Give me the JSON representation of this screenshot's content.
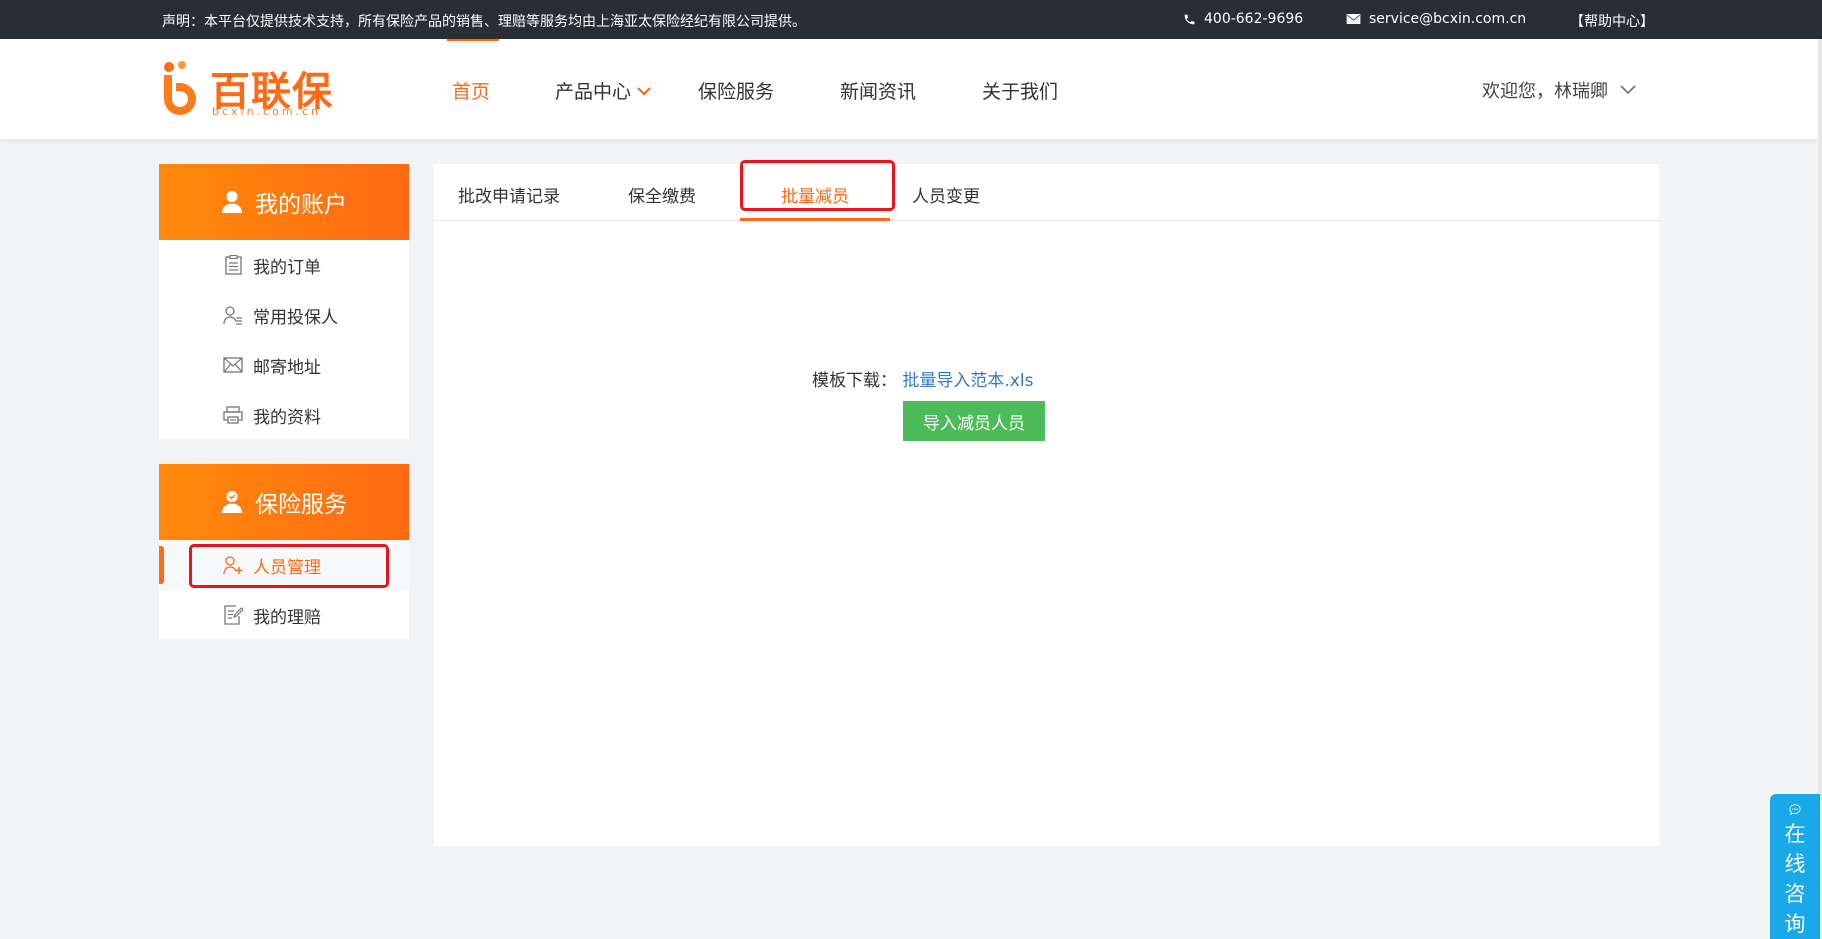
{
  "topbar": {
    "notice": "声明：本平台仅提供技术支持，所有保险产品的销售、理赔等服务均由上海亚太保险经纪有限公司提供。",
    "phone": "400-662-9696",
    "email": "service@bcxin.com.cn",
    "help": "【帮助中心】"
  },
  "logo": {
    "brand": "百联保",
    "domain": "bcxin.com.cn"
  },
  "nav": {
    "items": [
      {
        "label": "首页",
        "active": true
      },
      {
        "label": "产品中心"
      },
      {
        "label": "保险服务"
      },
      {
        "label": "新闻资讯"
      },
      {
        "label": "关于我们"
      }
    ]
  },
  "user": {
    "greeting": "欢迎您，林瑞卿"
  },
  "sidebar": {
    "account": {
      "title": "我的账户",
      "items": [
        {
          "label": "我的订单",
          "icon": "clipboard-icon"
        },
        {
          "label": "常用投保人",
          "icon": "person-list-icon"
        },
        {
          "label": "邮寄地址",
          "icon": "envelope-icon"
        },
        {
          "label": "我的资料",
          "icon": "printer-icon"
        }
      ]
    },
    "service": {
      "title": "保险服务",
      "items": [
        {
          "label": "人员管理",
          "icon": "person-add-icon",
          "active": true
        },
        {
          "label": "我的理赔",
          "icon": "edit-doc-icon"
        }
      ]
    }
  },
  "main": {
    "tabs": [
      {
        "label": "批改申请记录"
      },
      {
        "label": "保全缴费"
      },
      {
        "label": "批量减员",
        "active": true
      },
      {
        "label": "人员变更"
      }
    ],
    "template_label": "模板下载：",
    "template_link": "批量导入范本.xls",
    "import_button": "导入减员人员"
  },
  "chat": {
    "label": "在线咨询"
  },
  "colors": {
    "accent": "#ff6a13",
    "topbar": "#2b2d35",
    "button_green": "#4cbb5a",
    "link_blue": "#2f7bc9",
    "chat_blue": "#1aa8e8",
    "highlight_red": "#e8141c"
  }
}
